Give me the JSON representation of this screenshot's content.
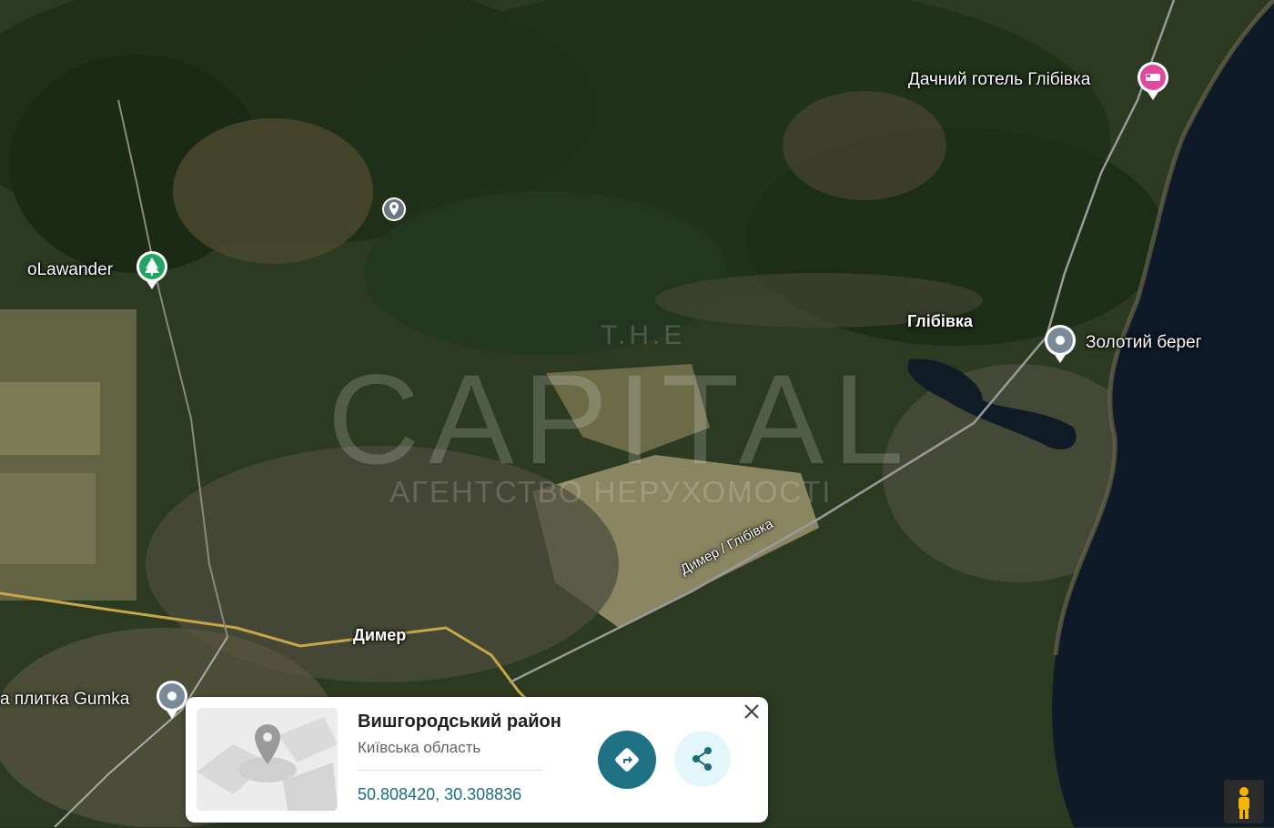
{
  "map": {
    "places": [
      {
        "name": "Дачний готель Глібівка",
        "icon": "hotel-bed-icon",
        "color": "#e2489b"
      },
      {
        "name": "oLawander",
        "icon": "tree-icon",
        "color": "#1fa463"
      },
      {
        "name": "Золотий берег",
        "icon": "place-pin-icon",
        "color": "#7a8a99"
      },
      {
        "name": "а плитка Gumka",
        "icon": "place-pin-icon",
        "color": "#7a8a99"
      }
    ],
    "settlements": {
      "glibivka": "Глібівка",
      "dymer": "Димер"
    },
    "road_label": "Димер / Глібівка",
    "watermark": {
      "top": "T.H.E",
      "main": "CAPITAL",
      "sub": "АГЕНТСТВО НЕРУХОМОСТІ"
    }
  },
  "card": {
    "title": "Вишгородський район",
    "subtitle": "Київська область",
    "coords": "50.808420, 30.308836",
    "directions_icon": "directions-icon",
    "share_icon": "share-icon",
    "close_icon": "close-icon",
    "accent": "#1f7184"
  },
  "controls": {
    "pegman_icon": "pegman-icon"
  }
}
